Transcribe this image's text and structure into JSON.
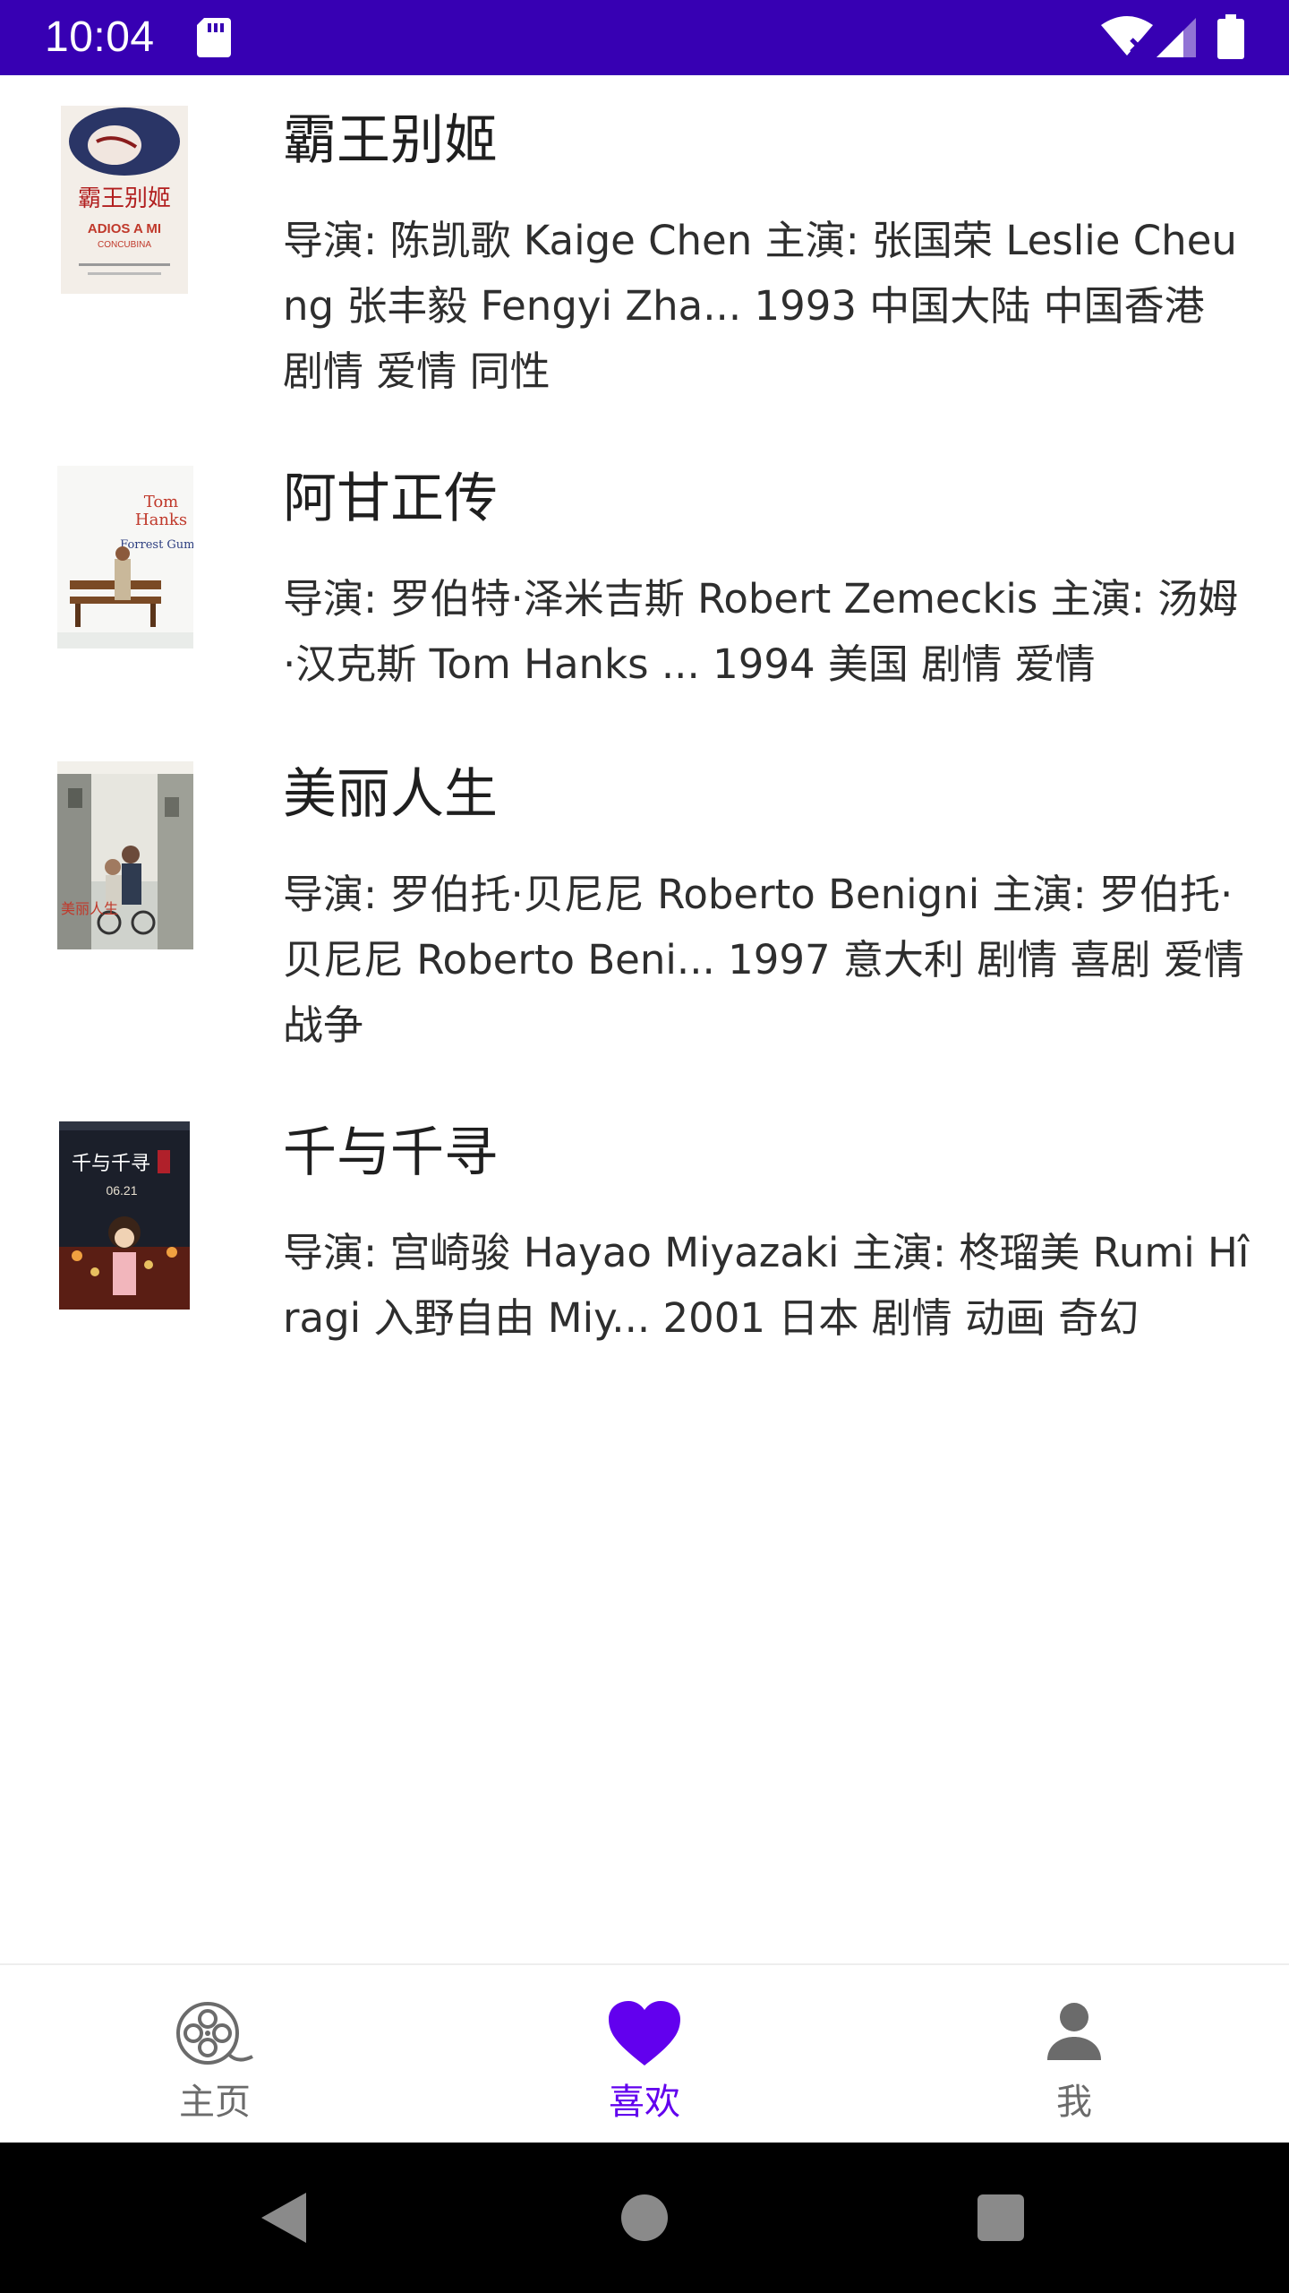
{
  "status_bar": {
    "time": "10:04",
    "background_color": "#3700b3",
    "icons": [
      "sd-card-icon",
      "wifi-icon",
      "signal-icon",
      "battery-icon"
    ]
  },
  "movies": [
    {
      "title": "霸王别姬",
      "description": "导演: 陈凯歌 Kaige Chen   主演: 张国荣 Leslie Cheung   张丰毅 Fengyi Zha... 1993   中国大陆 中国香港   剧情 爱情 同性",
      "poster": {
        "icon": "poster-image",
        "text_primary": "霸王别姬",
        "text_secondary": "ADIOS A MI",
        "text_tertiary": "CONCUBINA"
      }
    },
    {
      "title": "阿甘正传",
      "description": "导演: 罗伯特·泽米吉斯 Robert Zemeckis   主演: 汤姆·汉克斯 Tom Hanks   ... 1994   美国   剧情 爱情",
      "poster": {
        "icon": "poster-image",
        "text_primary": "Tom",
        "text_secondary": "Hanks",
        "text_tertiary": "Forrest Gump"
      }
    },
    {
      "title": "美丽人生",
      "description": "导演: 罗伯托·贝尼尼 Roberto Benigni   主演: 罗伯托·贝尼尼 Roberto Beni... 1997   意大利   剧情 喜剧 爱情 战争",
      "poster": {
        "icon": "poster-image",
        "text_primary": "美丽人生"
      }
    },
    {
      "title": "千与千寻",
      "description": "导演: 宫崎骏 Hayao Miyazaki   主演: 柊瑠美 Rumi Hîragi   入野自由 Miy... 2001   日本   剧情 动画 奇幻",
      "poster": {
        "icon": "poster-image",
        "text_primary": "千与千寻",
        "text_secondary": "06.21"
      }
    }
  ],
  "bottom_nav": {
    "items": [
      {
        "label": "主页",
        "icon": "film-reel-icon",
        "active": false
      },
      {
        "label": "喜欢",
        "icon": "heart-icon",
        "active": true
      },
      {
        "label": "我",
        "icon": "person-icon",
        "active": false
      }
    ],
    "active_color": "#6200ee",
    "inactive_color": "#6b6b6b"
  },
  "system_nav": {
    "buttons": [
      "back-icon",
      "home-icon",
      "recents-icon"
    ]
  }
}
